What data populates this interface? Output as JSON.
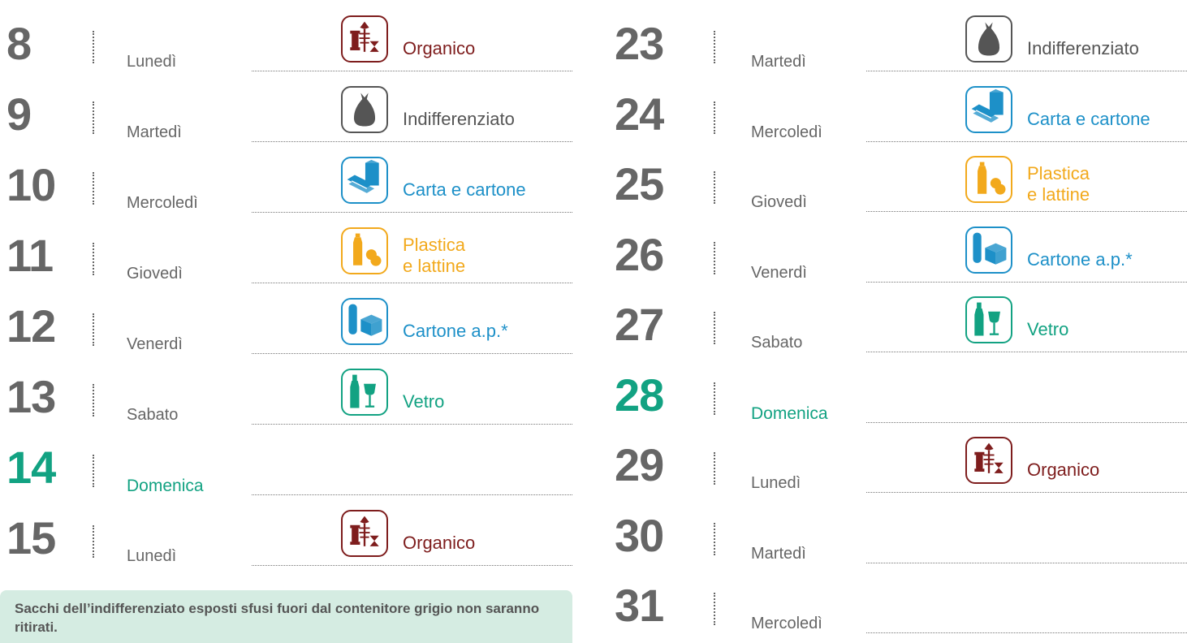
{
  "colors": {
    "number": "#666666",
    "sunday": "#12a282",
    "organico": "#7e1d1d",
    "indifferenziato": "#555555",
    "carta": "#1d90c8",
    "plastica": "#f2a91c",
    "cartone": "#1d90c8",
    "vetro": "#12a282",
    "note_bg": "#d5ece2"
  },
  "left": [
    {
      "day": "8",
      "weekday": "Lunedì",
      "waste": "Organico",
      "waste2": "",
      "icon": "organic-icon",
      "sunday": false
    },
    {
      "day": "9",
      "weekday": "Martedì",
      "waste": "Indifferenziato",
      "waste2": "",
      "icon": "bag-icon",
      "sunday": false
    },
    {
      "day": "10",
      "weekday": "Mercoledì",
      "waste": "Carta e cartone",
      "waste2": "",
      "icon": "paper-icon",
      "sunday": false
    },
    {
      "day": "11",
      "weekday": "Giovedì",
      "waste": "Plastica",
      "waste2": "e lattine",
      "icon": "plastic-icon",
      "sunday": false
    },
    {
      "day": "12",
      "weekday": "Venerdì",
      "waste": "Cartone a.p.*",
      "waste2": "",
      "icon": "carton-icon",
      "sunday": false
    },
    {
      "day": "13",
      "weekday": "Sabato",
      "waste": "Vetro",
      "waste2": "",
      "icon": "glass-icon",
      "sunday": false
    },
    {
      "day": "14",
      "weekday": "Domenica",
      "waste": "",
      "waste2": "",
      "icon": "",
      "sunday": true
    },
    {
      "day": "15",
      "weekday": "Lunedì",
      "waste": "Organico",
      "waste2": "",
      "icon": "organic-icon",
      "sunday": false
    }
  ],
  "right": [
    {
      "day": "23",
      "weekday": "Martedì",
      "waste": "Indifferenziato",
      "waste2": "",
      "icon": "bag-icon",
      "sunday": false
    },
    {
      "day": "24",
      "weekday": "Mercoledì",
      "waste": "Carta e cartone",
      "waste2": "",
      "icon": "paper-icon",
      "sunday": false
    },
    {
      "day": "25",
      "weekday": "Giovedì",
      "waste": "Plastica",
      "waste2": "e lattine",
      "icon": "plastic-icon",
      "sunday": false
    },
    {
      "day": "26",
      "weekday": "Venerdì",
      "waste": "Cartone a.p.*",
      "waste2": "",
      "icon": "carton-icon",
      "sunday": false
    },
    {
      "day": "27",
      "weekday": "Sabato",
      "waste": "Vetro",
      "waste2": "",
      "icon": "glass-icon",
      "sunday": false
    },
    {
      "day": "28",
      "weekday": "Domenica",
      "waste": "",
      "waste2": "",
      "icon": "",
      "sunday": true
    },
    {
      "day": "29",
      "weekday": "Lunedì",
      "waste": "Organico",
      "waste2": "",
      "icon": "organic-icon",
      "sunday": false
    },
    {
      "day": "30",
      "weekday": "Martedì",
      "waste": "",
      "waste2": "",
      "icon": "",
      "sunday": false
    },
    {
      "day": "31",
      "weekday": "Mercoledì",
      "waste": "",
      "waste2": "",
      "icon": "",
      "sunday": false
    }
  ],
  "note": "Sacchi dell’indifferenziato esposti sfusi fuori dal contenitore grigio non saranno ritirati."
}
